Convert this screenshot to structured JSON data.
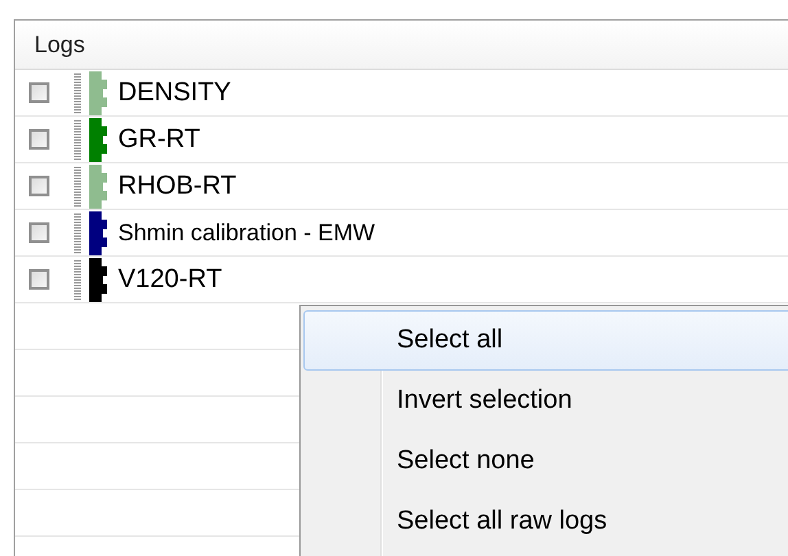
{
  "panel": {
    "title": "Logs"
  },
  "logs": [
    {
      "name": "DENSITY",
      "checked": false,
      "color": "#8fbc8f"
    },
    {
      "name": "GR-RT",
      "checked": false,
      "color": "#008000"
    },
    {
      "name": "RHOB-RT",
      "checked": false,
      "color": "#8fbc8f"
    },
    {
      "name": "Shmin calibration - EMW",
      "checked": false,
      "color": "#000080"
    },
    {
      "name": "V120-RT",
      "checked": false,
      "color": "#000000"
    }
  ],
  "context_menu": [
    {
      "label": "Select all",
      "selected": true
    },
    {
      "label": "Invert selection",
      "selected": false
    },
    {
      "label": "Select none",
      "selected": false
    },
    {
      "label": "Select all raw logs",
      "selected": false
    }
  ]
}
